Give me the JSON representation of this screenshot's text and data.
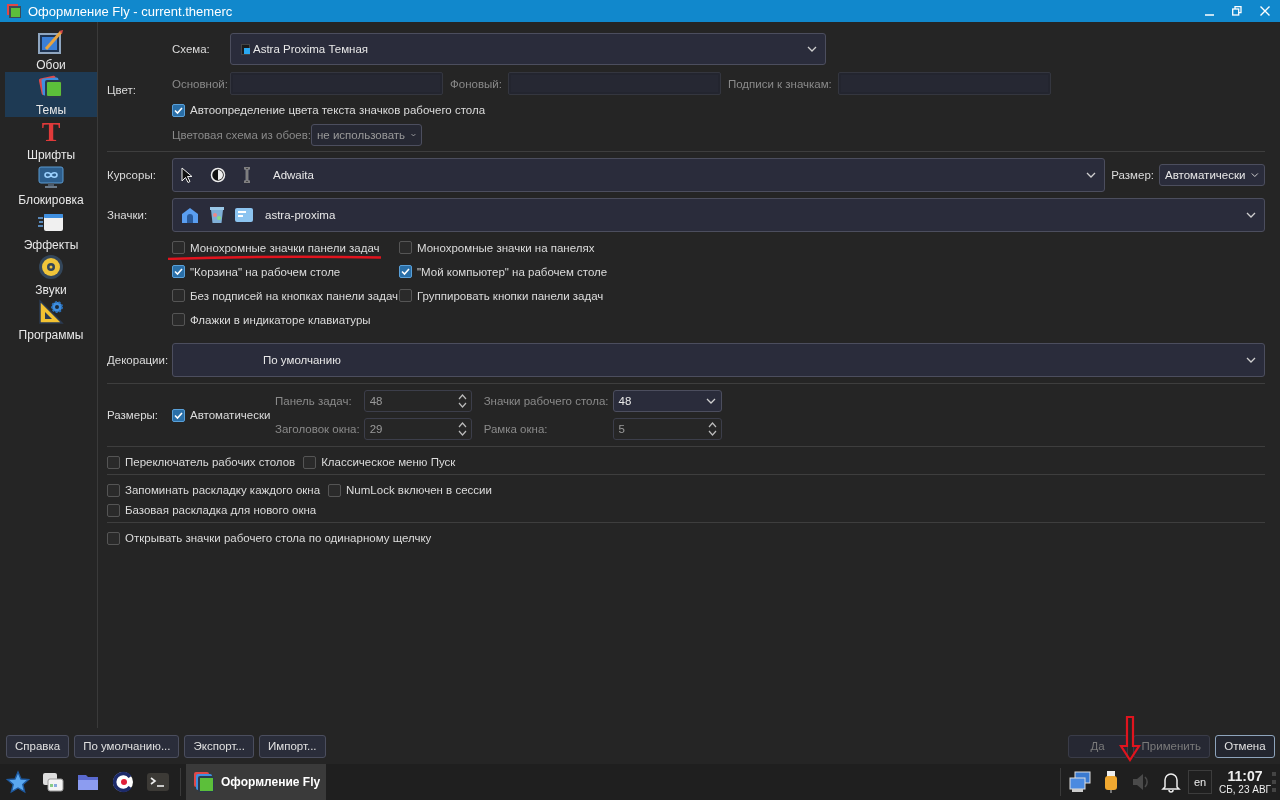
{
  "window": {
    "title": "Оформление Fly - current.themerc"
  },
  "sidebar": {
    "items": [
      {
        "label": "Обои",
        "kind": "wallpaper",
        "selected": false
      },
      {
        "label": "Темы",
        "kind": "themes",
        "selected": true
      },
      {
        "label": "Шрифты",
        "kind": "fonts",
        "icon": "T",
        "selected": false
      },
      {
        "label": "Блокировка",
        "kind": "lock",
        "selected": false
      },
      {
        "label": "Эффекты",
        "kind": "effects",
        "selected": false
      },
      {
        "label": "Звуки",
        "kind": "sounds",
        "selected": false
      },
      {
        "label": "Программы",
        "kind": "programs",
        "selected": false
      }
    ]
  },
  "color": {
    "label": "Цвет:",
    "scheme_label": "Схема:",
    "scheme": "Astra Proxima Темная",
    "fields": [
      {
        "label": "Основной:",
        "disabled": true
      },
      {
        "label": "Фоновый:",
        "disabled": true
      },
      {
        "label": "Подписи к значкам:",
        "disabled": true
      }
    ],
    "auto_text_color": {
      "label": "Автоопределение цвета текста значков рабочего стола",
      "checked": true
    },
    "wallpaper_scheme_label": "Цветовая схема из обоев:",
    "wallpaper_scheme": "не использовать",
    "wallpaper_scheme_disabled": true
  },
  "cursors": {
    "label": "Курсоры:",
    "value": "Adwaita",
    "size_label": "Размер:",
    "size": "Автоматически"
  },
  "icons": {
    "label": "Значки:",
    "value": "astra-proxima"
  },
  "icon_options": [
    {
      "label": "Монохромные значки панели задач",
      "checked": false
    },
    {
      "label": "Монохромные значки на панелях",
      "checked": false
    },
    {
      "label": "\"Корзина\" на рабочем столе",
      "checked": true
    },
    {
      "label": "\"Мой компьютер\" на рабочем столе",
      "checked": true
    },
    {
      "label": "Без подписей на кнопках панели задач",
      "checked": false
    },
    {
      "label": "Группировать кнопки панели задач",
      "checked": false
    },
    {
      "label": "Флажки в индикаторе клавиатуры",
      "checked": false
    }
  ],
  "decorations": {
    "label": "Декорации:",
    "value": "По умолчанию"
  },
  "sizes": {
    "label": "Размеры:",
    "auto": {
      "label": "Автоматически",
      "checked": true
    },
    "fields": [
      {
        "label": "Панель задач:",
        "value": "48",
        "kind": "spin",
        "disabled": true
      },
      {
        "label": "Значки рабочего стола:",
        "value": "48",
        "kind": "combo",
        "disabled": false
      },
      {
        "label": "Заголовок окна:",
        "value": "29",
        "kind": "spin",
        "disabled": true
      },
      {
        "label": "Рамка окна:",
        "value": "5",
        "kind": "spin",
        "disabled": true
      }
    ]
  },
  "option_groups": [
    {
      "rows": [
        {
          "options": [
            {
              "label": "Переключатель рабочих столов",
              "checked": false
            },
            {
              "label": "Классическое меню Пуск",
              "checked": false
            }
          ]
        }
      ]
    },
    {
      "rows": [
        {
          "options": [
            {
              "label": "Запоминать раскладку каждого окна",
              "checked": false
            },
            {
              "label": "NumLock включен в сессии",
              "checked": false
            }
          ]
        },
        {
          "options": [
            {
              "label": "Базовая раскладка для нового окна",
              "checked": false
            }
          ]
        }
      ]
    },
    {
      "rows": [
        {
          "options": [
            {
              "label": "Открывать значки рабочего стола по одинарному щелчку",
              "checked": false
            }
          ]
        }
      ]
    }
  ],
  "buttons_left": [
    "Справка",
    "По умолчанию...",
    "Экспорт...",
    "Импорт..."
  ],
  "buttons_right": [
    {
      "label": "Да",
      "disabled": true,
      "focused": false
    },
    {
      "label": "Применить",
      "disabled": true,
      "focused": false
    },
    {
      "label": "Отмена",
      "disabled": false,
      "focused": true
    }
  ],
  "taskbar": {
    "tasks": [
      {
        "label": "Оформление Fly",
        "selected": true
      }
    ],
    "language": "en",
    "time": "11:07",
    "date": "СБ, 23 АВГ"
  }
}
